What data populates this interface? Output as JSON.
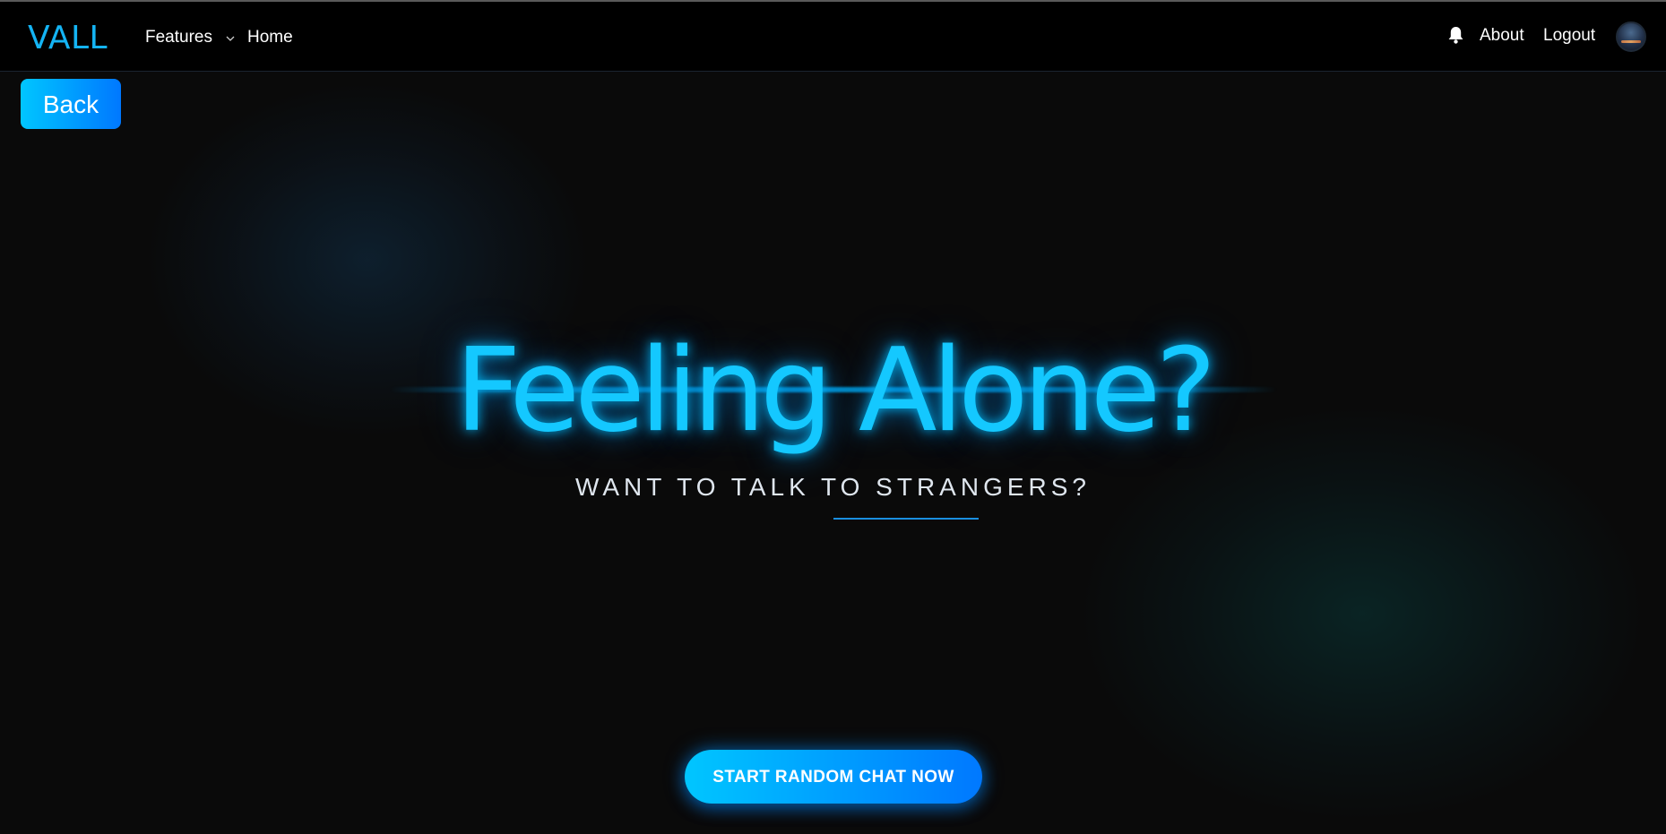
{
  "navbar": {
    "logo": "VALL",
    "features_label": "Features",
    "home_label": "Home",
    "about_label": "About",
    "logout_label": "Logout"
  },
  "back_button": {
    "label": "Back"
  },
  "hero": {
    "title": "Feeling Alone?",
    "subtitle": "WANT TO TALK TO STRANGERS?"
  },
  "cta": {
    "label": "START RANDOM CHAT NOW"
  },
  "icons": {
    "features_dropdown": "chevron-down-icon",
    "notifications": "bell-icon",
    "profile": "avatar"
  },
  "colors": {
    "brand": "#14b4f4",
    "gradient_start": "#00c6ff",
    "gradient_end": "#0078ff",
    "background": "#0a0a0a",
    "navbar": "#000000"
  }
}
